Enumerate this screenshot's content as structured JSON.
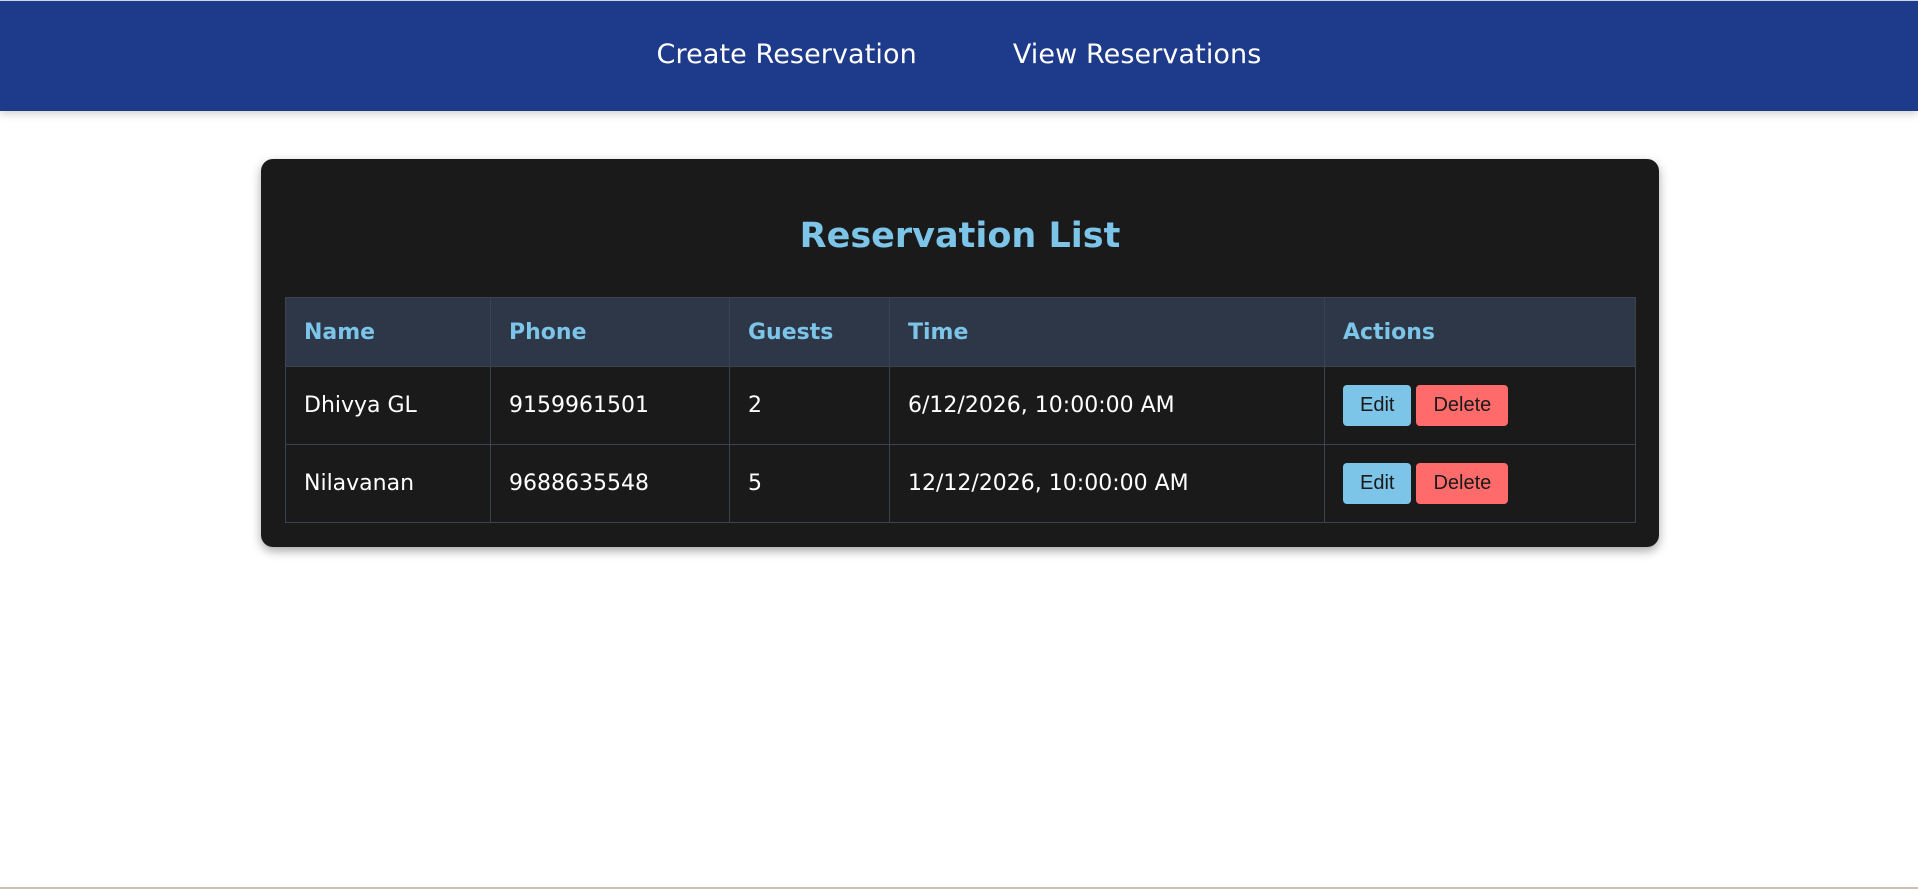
{
  "nav": {
    "create_label": "Create Reservation",
    "view_label": "View Reservations"
  },
  "main": {
    "title": "Reservation List",
    "columns": [
      "Name",
      "Phone",
      "Guests",
      "Time",
      "Actions"
    ],
    "rows": [
      {
        "name": "Dhivya GL",
        "phone": "9159961501",
        "guests": "2",
        "time": "6/12/2026, 10:00:00 AM"
      },
      {
        "name": "Nilavanan",
        "phone": "9688635548",
        "guests": "5",
        "time": "12/12/2026, 10:00:00 AM"
      }
    ],
    "edit_label": "Edit",
    "delete_label": "Delete"
  },
  "colors": {
    "navbar": "#1e3a8a",
    "card": "#1a1a1a",
    "accent": "#7cc4e8",
    "header_bg": "#2d3748",
    "delete": "#ff6b6b"
  }
}
